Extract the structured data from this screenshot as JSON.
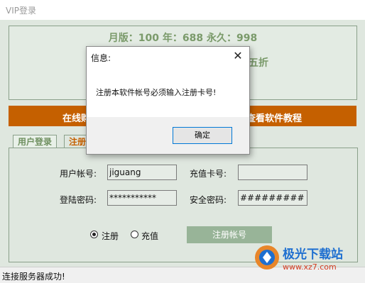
{
  "window": {
    "title": "VIP登录"
  },
  "pricing": {
    "line1": "月版：100 年：688 永久：998",
    "line2": "00五折"
  },
  "banner": {
    "left": "在线购",
    "right": "查看软件教程"
  },
  "tabs": [
    {
      "label": "用户登录"
    },
    {
      "label": "注册"
    }
  ],
  "form": {
    "username_label": "用户帐号:",
    "username_value": "jiguang",
    "card_label": "充值卡号:",
    "card_value": "",
    "password_label": "登陆密码:",
    "password_value": "***********",
    "security_label": "安全密码:",
    "security_value": "#########",
    "radio_register": "注册",
    "radio_recharge": "充值",
    "register_button": "注册帐号"
  },
  "status": {
    "text": "连接服务器成功!"
  },
  "dialog": {
    "title": "信息:",
    "message": "注册本软件帐号必须输入注册卡号!",
    "ok": "确定"
  },
  "watermark": {
    "name": "极光下载站",
    "url": "www.xz7.com"
  },
  "colors": {
    "banner": "#c56000",
    "accent_green": "#7a9a6a",
    "register_button": "#98b498"
  }
}
